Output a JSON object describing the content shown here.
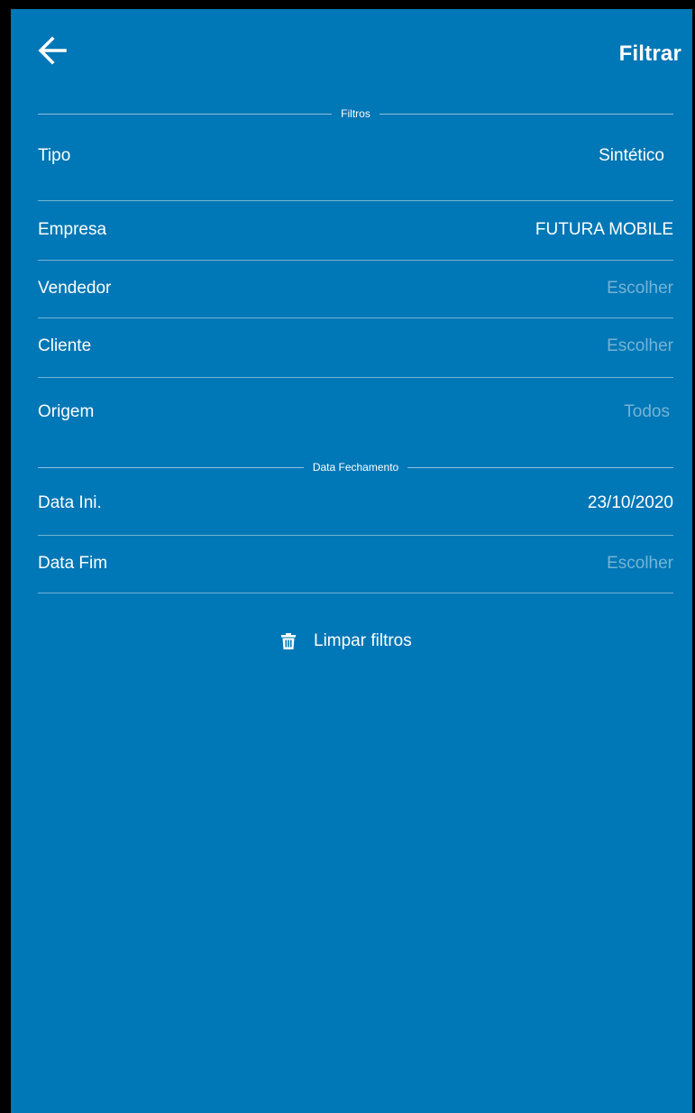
{
  "header": {
    "back_icon": "arrow-left-icon",
    "action_label": "Filtrar"
  },
  "sections": {
    "filtros_label": "Filtros",
    "data_fechamento_label": "Data Fechamento"
  },
  "rows": {
    "tipo": {
      "label": "Tipo",
      "value": "Sintético"
    },
    "empresa": {
      "label": "Empresa",
      "value": "FUTURA MOBILE"
    },
    "vendedor": {
      "label": "Vendedor",
      "value": "Escolher"
    },
    "cliente": {
      "label": "Cliente",
      "value": "Escolher"
    },
    "origem": {
      "label": "Origem",
      "value": "Todos"
    },
    "data_ini": {
      "label": "Data Ini.",
      "value": "23/10/2020"
    },
    "data_fim": {
      "label": "Data Fim",
      "value": "Escolher"
    }
  },
  "clear": {
    "icon": "trash-icon",
    "label": "Limpar filtros"
  },
  "colors": {
    "background": "#0077B6",
    "text": "#FFFFFF",
    "placeholder": "rgba(255,255,255,0.45)"
  }
}
